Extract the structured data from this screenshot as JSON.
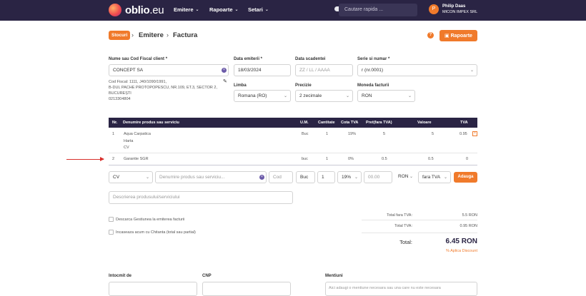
{
  "app": {
    "logo_prefix": "oblio",
    "logo_suffix": ".eu",
    "nav": [
      "Emitere",
      "Rapoarte",
      "Setari"
    ],
    "search_placeholder": "Cautare rapida ...",
    "user_name": "Philip Daas",
    "user_company": "MICON IMPEX SRL",
    "user_initial": "P"
  },
  "breadcrumb": {
    "badge": "Stocuri",
    "items": [
      "Emitere",
      "Factura"
    ],
    "reports_button": "Rapoarte"
  },
  "client": {
    "label": "Nume sau Cod Fiscal client *",
    "value": "CONCEPT SA",
    "details": [
      "Cod Fiscal: 1111, J40/1090/1991,",
      "B-DUL PACHE PROTOPOPESCU, NR.109, ET.3, SECTOR 2,",
      "BUCUREȘTI",
      "0213304804"
    ]
  },
  "issue_date": {
    "label": "Data emiterii *",
    "value": "18/03/2024"
  },
  "due_date": {
    "label": "Data scadentei",
    "placeholder": "ZZ / LL / AAAA"
  },
  "series": {
    "label": "Serie si numar *",
    "value": "r (nr.0001)"
  },
  "language": {
    "label": "Limba",
    "value": "Romana (RO)"
  },
  "precision": {
    "label": "Precizie",
    "value": "2 zecimale"
  },
  "currency": {
    "label": "Moneda facturii",
    "value": "RON"
  },
  "table": {
    "headers": [
      "Nr.",
      "Denumire produs sau serviciu",
      "U.M.",
      "Cantitate",
      "Cota TVA",
      "Pret(fara TVA)",
      "Valoare",
      "TVA"
    ],
    "rows": [
      {
        "nr": "1",
        "name": "Aqua Carpatica",
        "sub1": "Harta",
        "sub2": "CV",
        "um": "Buc",
        "qty": "1",
        "vat": "19%",
        "price": "5",
        "value": "5",
        "tva": "0.95"
      },
      {
        "nr": "2",
        "name": "Garantie SGR",
        "sub1": "",
        "sub2": "",
        "um": "buc",
        "qty": "1",
        "vat": "0%",
        "price": "0.5",
        "value": "0.5",
        "tva": "0"
      }
    ]
  },
  "entry": {
    "type": "CV",
    "name_placeholder": "Denumire produs sau serviciu...",
    "code_placeholder": "Cod",
    "um": "Buc",
    "qty": "1",
    "vat": "19%",
    "price_placeholder": "00.00",
    "currency": "RON",
    "vat_mode": "fara TVA",
    "add_button": "Adauga",
    "description_placeholder": "Descrierea produsului/serviciului"
  },
  "options": [
    "Descarca Gestiunea la emiterea facturii",
    "Incaseaza acum cu Chitanta (total sau partial)"
  ],
  "totals": {
    "net_label": "Total fara TVA:",
    "net_value": "5.5 RON",
    "vat_label": "Total TVA:",
    "vat_value": "0.95 RON",
    "total_label": "Total:",
    "total_value": "6.45 RON",
    "discount": "% Aplica Discount"
  },
  "footer": {
    "issued_by": "Intocmit de",
    "cnp": "CNP",
    "mentions": "Mentiuni",
    "mentions_placeholder": "Aici adaugi o mentiune necesara sau una care nu este necesara"
  }
}
